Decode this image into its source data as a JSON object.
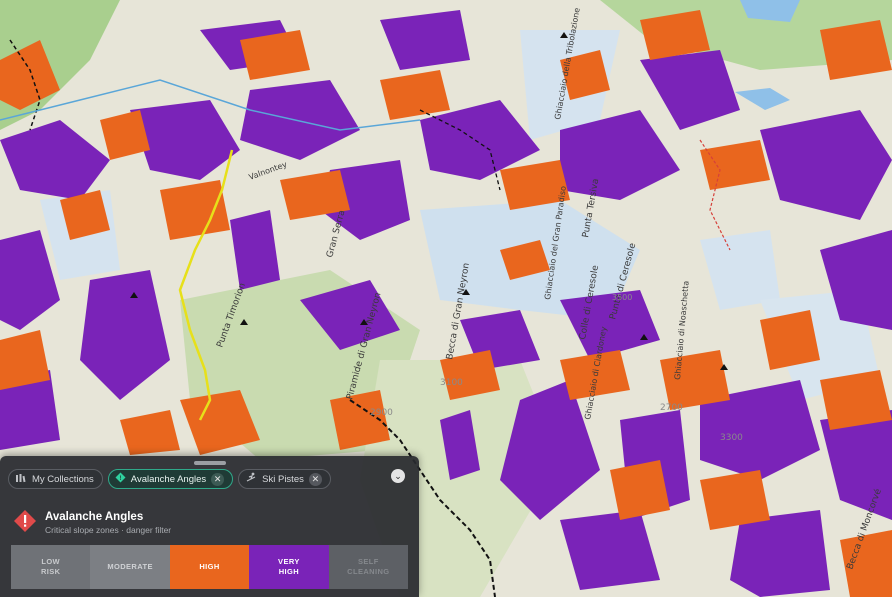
{
  "map": {
    "labels": [
      "Punta Timorion",
      "Piramide di Gran Neyron",
      "Becca di Gran Neyron",
      "Punta di Ceresole",
      "Colle di Ceresole",
      "Punta Tersiva",
      "Gran Serra",
      "Becca di Moncorvé",
      "Ghiacciaio di Noaschetta",
      "Ghiacciaio di Ciardoney",
      "Ghiacciaio del Gran Paradiso",
      "Ghiacciaio della Tribolazione",
      "Valnontey",
      "3100",
      "3300",
      "2900",
      "2700",
      "3500"
    ],
    "colors": {
      "high": "#e9661e",
      "very_high": "#7a23b8",
      "glacier": "#cfe0ee",
      "forest": "#a9cf8e",
      "rock": "#e7e5d8",
      "trail_yellow": "#e7e01a",
      "trail_black": "#111111"
    }
  },
  "panel": {
    "chips": [
      {
        "label": "My Collections",
        "icon": "collections-icon",
        "active": false
      },
      {
        "label": "Avalanche Angles",
        "icon": "avalanche-icon",
        "active": true
      },
      {
        "label": "Ski Pistes",
        "icon": "ski-icon",
        "active": false
      }
    ],
    "layer": {
      "title": "Avalanche Angles",
      "subtitle": "Critical slope zones · danger filter",
      "icon": "warning-icon",
      "icon_color": "#e04a4a"
    },
    "levels": [
      {
        "label": "LOW\nRISK",
        "color": "#6f7277"
      },
      {
        "label": "MODERATE",
        "color": "#7c7f84"
      },
      {
        "label": "HIGH",
        "color": "#e9661e"
      },
      {
        "label": "VERY\nHIGH",
        "color": "#7a23b8"
      },
      {
        "label": "SELF\nCLEANING",
        "color": "#5d6065"
      }
    ]
  }
}
